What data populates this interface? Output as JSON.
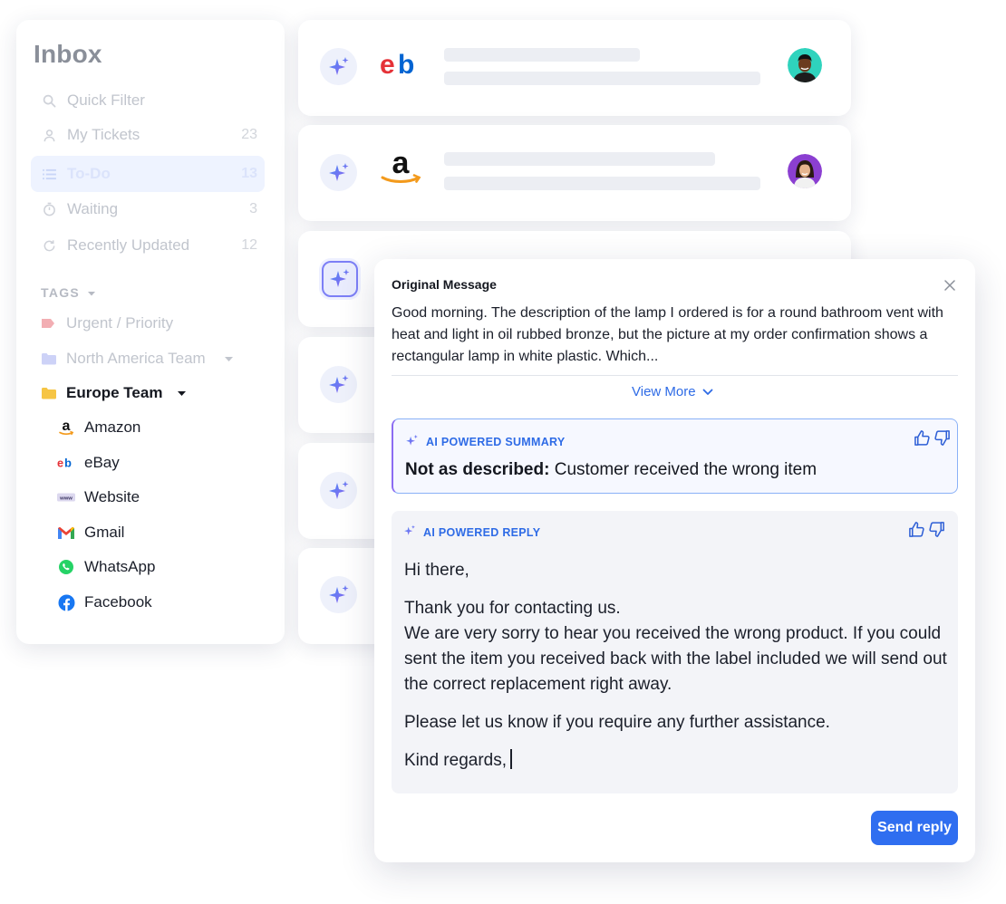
{
  "sidebar": {
    "title": "Inbox",
    "nav": [
      {
        "label": "Quick Filter",
        "count": "",
        "icon": "search-icon"
      },
      {
        "label": "My Tickets",
        "count": "23",
        "icon": "user-icon"
      },
      {
        "label": "To-Do",
        "count": "13",
        "icon": "list-icon"
      },
      {
        "label": "Waiting",
        "count": "3",
        "icon": "stopwatch-icon"
      },
      {
        "label": "Recently Updated",
        "count": "12",
        "icon": "refresh-icon"
      }
    ],
    "tags_header": "TAGS",
    "tags": [
      {
        "label": "Urgent / Priority",
        "icon": "tag-icon"
      },
      {
        "label": "North America Team",
        "icon": "folder-icon"
      },
      {
        "label": "Europe Team",
        "icon": "folder-icon"
      }
    ],
    "channels": [
      {
        "label": "Amazon",
        "icon": "amazon-icon"
      },
      {
        "label": "eBay",
        "icon": "ebay-icon"
      },
      {
        "label": "Website",
        "icon": "www-icon"
      },
      {
        "label": "Gmail",
        "icon": "gmail-icon"
      },
      {
        "label": "WhatsApp",
        "icon": "whatsapp-icon"
      },
      {
        "label": "Facebook",
        "icon": "facebook-icon"
      }
    ]
  },
  "tickets": [
    {
      "brand": "eBay",
      "brand_logo_text": "eb"
    },
    {
      "brand": "Amazon",
      "brand_logo_text": "a"
    }
  ],
  "panel": {
    "title": "Original Message",
    "message": "Good morning. The description of the lamp I ordered is for a round bathroom vent with heat and light in oil rubbed bronze, but the picture at my order confirmation shows a rectangular lamp in white plastic. Which...",
    "view_more": "View More",
    "summary": {
      "label": "AI POWERED SUMMARY",
      "bold": "Not as described:",
      "text": "Customer received the wrong item"
    },
    "reply": {
      "label": "AI POWERED REPLY",
      "greeting": "Hi there,",
      "line1": "Thank you for contacting us.",
      "line2": "We are very sorry to hear you received the wrong product. If you could sent the item you received back with the label included we will send out the correct replacement right away.",
      "line3": "Please let us know if you require any further assistance.",
      "signoff": "Kind regards,"
    },
    "send_button": "Send reply"
  },
  "colors": {
    "accent": "#2f6ef0",
    "ai_purple": "#8b6cf2",
    "tag_red": "#f0a9ae",
    "folder_blue": "#c7cdf7",
    "folder_yellow": "#f6c544"
  }
}
